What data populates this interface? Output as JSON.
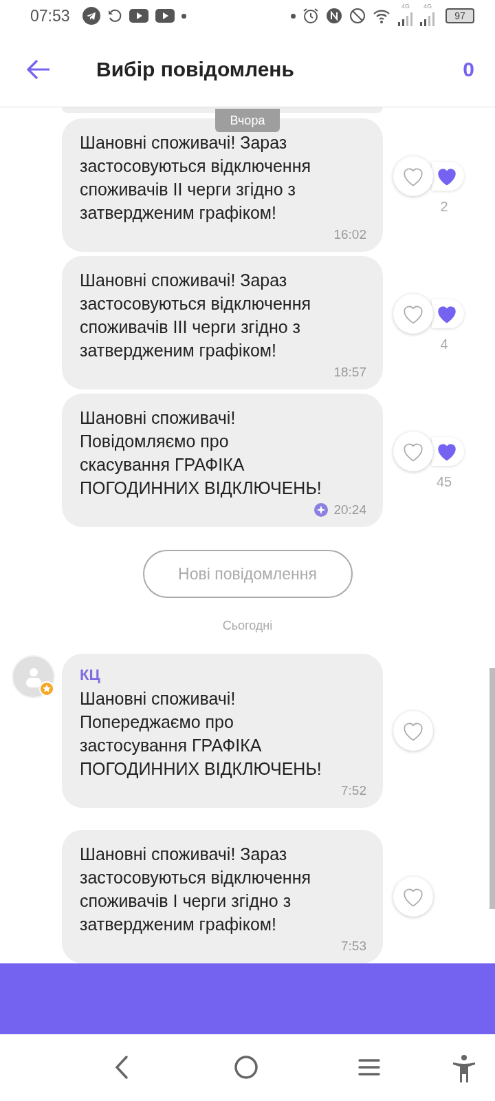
{
  "status_bar": {
    "time": "07:53",
    "network_labels": [
      "4G",
      "4G"
    ],
    "battery": "97"
  },
  "header": {
    "title": "Вибір повідомлень",
    "selected_count": "0"
  },
  "date_chip": "Вчора",
  "messages": [
    {
      "text": "Шановні споживачі! Зараз\nзастосовуються відключення\nспоживачів ІІ черги згідно з\nзатвердженим графіком!",
      "time": "16:02",
      "edited": false,
      "liked": false,
      "reactions": "2"
    },
    {
      "text": "Шановні споживачі! Зараз\nзастосовуються відключення\nспоживачів ІІІ черги згідно з\nзатвердженим графіком!",
      "time": "18:57",
      "edited": false,
      "liked": false,
      "reactions": "4"
    },
    {
      "text": "Шановні споживачі!\nПовідомляємо про\nскасування ГРАФІКА\nПОГОДИННИХ ВІДКЛЮЧЕНЬ!",
      "time": "20:24",
      "edited": true,
      "liked": false,
      "reactions": "45"
    }
  ],
  "new_messages_button": "Нові повідомлення",
  "today_label": "Сьогодні",
  "today_messages": [
    {
      "sender": "КЦ",
      "text": "Шановні споживачі!\nПопереджаємо про\nзастосування ГРАФІКА\nПОГОДИННИХ ВІДКЛЮЧЕНЬ!",
      "time": "7:52",
      "edited": false,
      "liked": false
    },
    {
      "text": "Шановні споживачі! Зараз\nзастосовуються відключення\nспоживачів І черги згідно з\nзатвердженим графіком!",
      "time": "7:53",
      "edited": false,
      "liked": false
    }
  ]
}
